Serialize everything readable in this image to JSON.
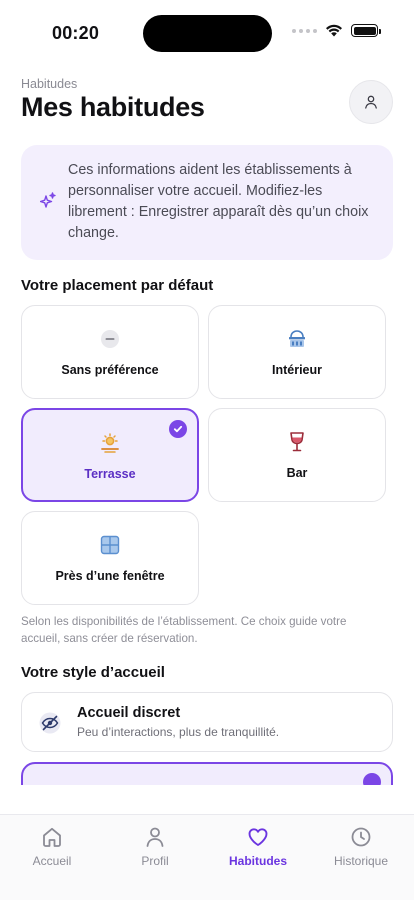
{
  "status_bar": {
    "time": "00:20"
  },
  "header": {
    "eyebrow": "Habitudes",
    "title": "Mes habitudes"
  },
  "info_card": {
    "icon": "sparkles-icon",
    "text": "Ces informations aident les établissements à personnaliser votre accueil. Modifiez-les librement : Enregistrer apparaît dès qu’un choix change."
  },
  "placement": {
    "title": "Votre placement par défaut",
    "options": [
      {
        "label": "Sans préférence",
        "icon": "minus-circle-icon",
        "selected": false
      },
      {
        "label": "Intérieur",
        "icon": "building-icon",
        "selected": false
      },
      {
        "label": "Terrasse",
        "icon": "sun-icon",
        "selected": true
      },
      {
        "label": "Bar",
        "icon": "wine-glass-icon",
        "selected": false
      },
      {
        "label": "Près d’une fenêtre",
        "icon": "window-icon",
        "selected": false
      }
    ],
    "helper": "Selon les disponibilités de l’établissement. Ce choix guide votre accueil, sans créer de réservation."
  },
  "welcome_style": {
    "title": "Votre style d’accueil",
    "options": [
      {
        "title": "Accueil discret",
        "subtitle": "Peu d’interactions, plus de tranquillité.",
        "icon": "eye-off-icon",
        "selected": false
      }
    ]
  },
  "tab_bar": {
    "tabs": [
      {
        "label": "Accueil",
        "icon": "home-icon",
        "active": false
      },
      {
        "label": "Profil",
        "icon": "person-icon",
        "active": false
      },
      {
        "label": "Habitudes",
        "icon": "heart-icon",
        "active": true
      },
      {
        "label": "Historique",
        "icon": "clock-icon",
        "active": false
      }
    ]
  },
  "colors": {
    "accent": "#7b46e6",
    "accent_soft": "#f1ecfd",
    "info_bg": "#f3effd"
  }
}
